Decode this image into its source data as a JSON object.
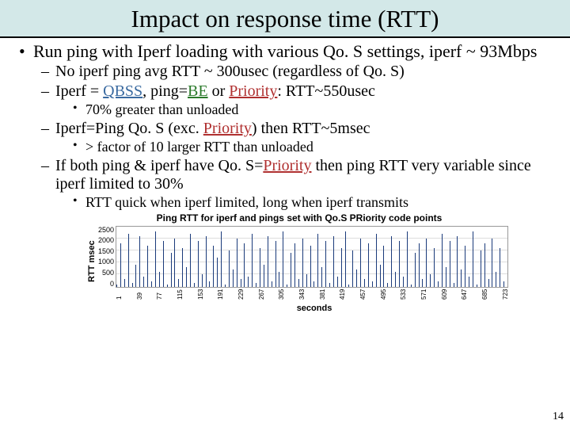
{
  "title": "Impact on response time (RTT)",
  "page_number": "14",
  "bullets": {
    "main": "Run ping with Iperf loading with various Qo. S settings, iperf ~ 93Mbps",
    "sub1": "No iperf ping avg RTT ~ 300usec (regardless of Qo. S)",
    "sub2_pre": "Iperf = ",
    "sub2_qbss": "QBSS",
    "sub2_mid1": ", ping=",
    "sub2_be": "BE",
    "sub2_mid2": " or ",
    "sub2_prio": "Priority",
    "sub2_post": ": RTT~550usec",
    "sub2_child": "70% greater than unloaded",
    "sub3_pre": "Iperf=Ping Qo. S (exc. ",
    "sub3_prio": "Priority",
    "sub3_post": ") then RTT~5msec",
    "sub3_child": "> factor of 10 larger RTT than unloaded",
    "sub4_pre": "If both ping & iperf have Qo. S=",
    "sub4_prio": "Priority",
    "sub4_post": " then ping RTT very variable since iperf limited to 30%",
    "sub4_child": "RTT quick when iperf limited, long when iperf transmits"
  },
  "chart_data": {
    "type": "line",
    "title": "Ping RTT for iperf and pings set with Qo.S PRiority code points",
    "ylabel": "RTT msec",
    "xlabel": "seconds",
    "ylim": [
      0,
      2500
    ],
    "yticks": [
      0,
      500,
      1000,
      1500,
      2000,
      2500
    ],
    "xrange": [
      1,
      723
    ],
    "xticks": [
      1,
      39,
      77,
      115,
      153,
      191,
      229,
      267,
      305,
      343,
      381,
      419,
      457,
      495,
      533,
      571,
      609,
      647,
      685,
      723
    ],
    "note": "Dense spiky time series; values visually oscillate between approximately 0 and 2300, with many spikes reaching 1500–2300 and troughs near 0–200.",
    "sample_spikes": [
      100,
      1800,
      300,
      2200,
      150,
      900,
      2100,
      400,
      1700,
      200,
      2300,
      600,
      1900,
      100,
      1400,
      2000,
      300,
      1600,
      800,
      2200,
      150,
      1900,
      500,
      2100,
      200,
      1700,
      1200,
      2300,
      100,
      1500,
      700,
      2000,
      300,
      1800,
      400,
      2200,
      150,
      1600,
      900,
      2100,
      200,
      1900,
      600,
      2300,
      100,
      1400,
      1800,
      300,
      2000,
      500,
      1700,
      200,
      2200,
      800,
      1900,
      150,
      2100,
      400,
      1600,
      2300,
      100,
      1500,
      700,
      2000,
      300,
      1800,
      200,
      2200,
      900,
      1700,
      150,
      2100,
      600,
      1900,
      400,
      2300,
      100,
      1400,
      1800,
      300,
      2000,
      500,
      1600,
      200,
      2200,
      800,
      1900,
      150,
      2100,
      700,
      1700,
      400,
      2300,
      100,
      1500,
      1800,
      300,
      2000,
      600,
      1600,
      200
    ]
  }
}
